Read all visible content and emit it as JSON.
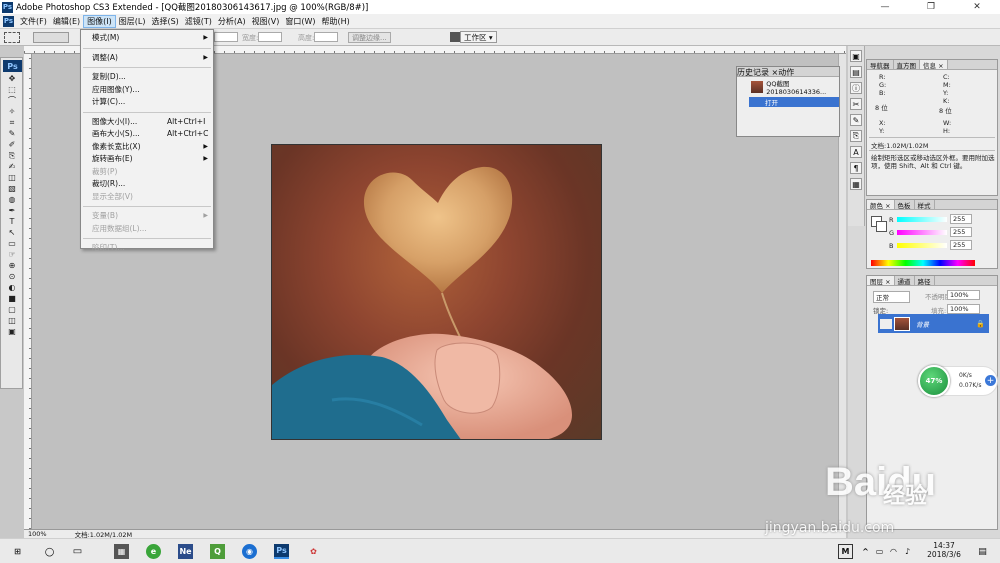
{
  "app": {
    "title": "Adobe Photoshop CS3 Extended - [QQ截图20180306143617.jpg @ 100%(RGB/8#)]",
    "logo": "Ps",
    "window_controls": [
      "—",
      "❐",
      "✕"
    ]
  },
  "menubar": {
    "items": [
      "文件(F)",
      "编辑(E)",
      "图像(I)",
      "图层(L)",
      "选择(S)",
      "滤镜(T)",
      "分析(A)",
      "视图(V)",
      "窗口(W)",
      "帮助(H)"
    ],
    "active_index": 2
  },
  "options": {
    "width_label": "宽度:",
    "height_label": "高度:",
    "refine_edge": "调整边缘...",
    "workspace": "工作区 ▾"
  },
  "image_menu": {
    "items": [
      {
        "label": "模式(M)",
        "shortcut": "",
        "submenu": true,
        "disabled": false
      },
      {
        "sep": true
      },
      {
        "label": "调整(A)",
        "shortcut": "",
        "submenu": true,
        "disabled": false
      },
      {
        "sep": true
      },
      {
        "label": "复制(D)...",
        "shortcut": "",
        "submenu": false,
        "disabled": false
      },
      {
        "label": "应用图像(Y)...",
        "shortcut": "",
        "submenu": false,
        "disabled": false
      },
      {
        "label": "计算(C)...",
        "shortcut": "",
        "submenu": false,
        "disabled": false
      },
      {
        "sep": true
      },
      {
        "label": "图像大小(I)...",
        "shortcut": "Alt+Ctrl+I",
        "submenu": false,
        "disabled": false
      },
      {
        "label": "画布大小(S)...",
        "shortcut": "Alt+Ctrl+C",
        "submenu": false,
        "disabled": false
      },
      {
        "label": "像素长宽比(X)",
        "shortcut": "",
        "submenu": true,
        "disabled": false
      },
      {
        "label": "旋转画布(E)",
        "shortcut": "",
        "submenu": true,
        "disabled": false
      },
      {
        "label": "裁剪(P)",
        "shortcut": "",
        "submenu": false,
        "disabled": true
      },
      {
        "label": "裁切(R)...",
        "shortcut": "",
        "submenu": false,
        "disabled": false
      },
      {
        "label": "显示全部(V)",
        "shortcut": "",
        "submenu": false,
        "disabled": true
      },
      {
        "sep": true
      },
      {
        "label": "变量(B)",
        "shortcut": "",
        "submenu": true,
        "disabled": true
      },
      {
        "label": "应用数据组(L)...",
        "shortcut": "",
        "submenu": false,
        "disabled": true
      },
      {
        "sep": true
      },
      {
        "label": "陷印(T)...",
        "shortcut": "",
        "submenu": false,
        "disabled": true
      }
    ]
  },
  "history_panel": {
    "tabs": [
      "历史记录 ×",
      "动作"
    ],
    "snapshot": "QQ截图2018030614336...",
    "step": "打开"
  },
  "nav_panel": {
    "tabs": [
      "导航器",
      "直方图",
      "信息 ×"
    ],
    "labels_left": [
      "R:",
      "G:",
      "B:",
      "8 位",
      "X:",
      "Y:"
    ],
    "labels_right": [
      "C:",
      "M:",
      "Y:",
      "K:",
      "8 位",
      "W:",
      "H:"
    ],
    "doc_size": "文档:1.02M/1.02M",
    "hint": "绘制矩形选区或移动选区外框。要用附加选项，使用 Shift、Alt 和 Ctrl 键。"
  },
  "color_panel": {
    "tabs": [
      "颜色 ×",
      "色板",
      "样式"
    ],
    "channels": [
      {
        "name": "R",
        "value": "255"
      },
      {
        "name": "G",
        "value": "255"
      },
      {
        "name": "B",
        "value": "255"
      }
    ]
  },
  "layers_panel": {
    "tabs": [
      "图层 ×",
      "通道",
      "路径"
    ],
    "blend_mode": "正常",
    "opacity_label": "不透明度:",
    "opacity": "100%",
    "lock_label": "锁定:",
    "fill_label": "填充:",
    "fill": "100%",
    "layer_name": "背景"
  },
  "status": {
    "zoom": "100%",
    "doc": "文档:1.02M/1.02M"
  },
  "speed_widget": {
    "percent": "47%",
    "up": "0K/s",
    "down": "0.07K/s"
  },
  "taskbar": {
    "time": "14:37",
    "date": "2018/3/6",
    "ime": "M"
  },
  "watermark": {
    "brand": "Bai",
    "brand2": "du",
    "cn": "经验",
    "url": "jingyan.baidu.com"
  },
  "colors": {
    "menu_highlight": "#cde4f7",
    "layer_selected": "#3a73d0",
    "ps_blue": "#0d3a6e"
  }
}
